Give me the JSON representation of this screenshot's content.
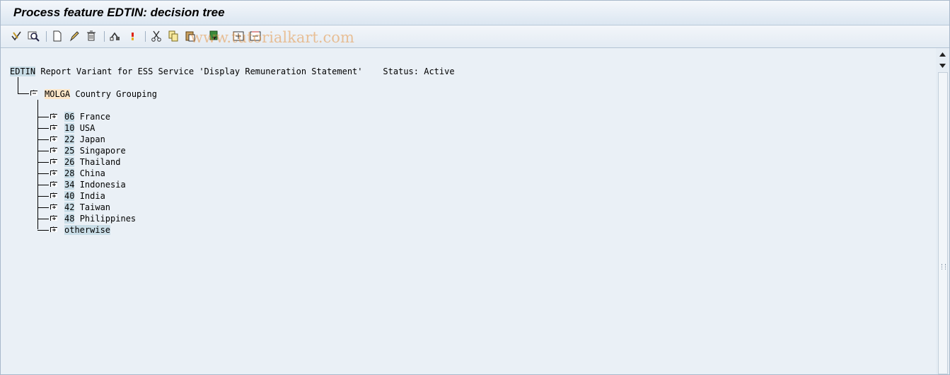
{
  "window": {
    "title": "Process feature EDTIN: decision tree"
  },
  "watermark": "www.tutorialkart.com",
  "toolbar": {
    "buttons": [
      {
        "name": "check-icon"
      },
      {
        "name": "display-icon"
      },
      {
        "name": "new-icon"
      },
      {
        "name": "edit-icon"
      },
      {
        "name": "delete-icon"
      },
      {
        "name": "transport-icon"
      },
      {
        "name": "info-icon"
      },
      {
        "name": "cut-icon"
      },
      {
        "name": "copy-icon"
      },
      {
        "name": "paste-icon"
      },
      {
        "name": "insert-icon"
      },
      {
        "name": "expand-icon"
      },
      {
        "name": "collapse-icon"
      }
    ]
  },
  "header": {
    "feature": "EDTIN",
    "description": "Report Variant for ESS Service 'Display Remuneration Statement'",
    "status": "Status: Active"
  },
  "root_node": {
    "field": "MOLGA",
    "label": "Country Grouping"
  },
  "countries": [
    {
      "code": "06",
      "name": "France"
    },
    {
      "code": "10",
      "name": "USA"
    },
    {
      "code": "22",
      "name": "Japan"
    },
    {
      "code": "25",
      "name": "Singapore"
    },
    {
      "code": "26",
      "name": "Thailand"
    },
    {
      "code": "28",
      "name": "China"
    },
    {
      "code": "34",
      "name": "Indonesia"
    },
    {
      "code": "40",
      "name": "India"
    },
    {
      "code": "42",
      "name": "Taiwan"
    },
    {
      "code": "48",
      "name": "Philippines"
    }
  ],
  "otherwise_label": "otherwise",
  "colors": {
    "title_bg": "#dbe6f1",
    "content_bg": "#eaf0f6",
    "key_highlight": "#c9dde7",
    "molga_highlight": "#fde6c8"
  }
}
